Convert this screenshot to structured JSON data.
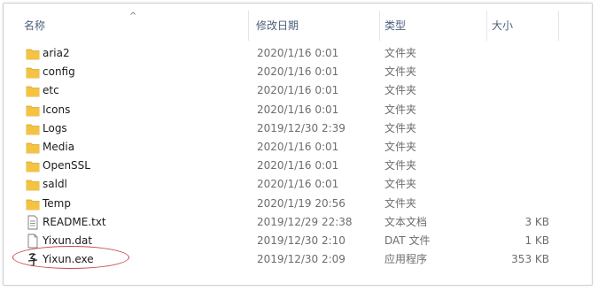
{
  "columns": {
    "name": "名称",
    "date": "修改日期",
    "type": "类型",
    "size": "大小"
  },
  "sort_indicator": "^",
  "files": [
    {
      "name": "aria2",
      "date": "2020/1/16 0:01",
      "type": "文件夹",
      "size": "",
      "icon": "folder-icon"
    },
    {
      "name": "config",
      "date": "2020/1/16 0:01",
      "type": "文件夹",
      "size": "",
      "icon": "folder-icon"
    },
    {
      "name": "etc",
      "date": "2020/1/16 0:01",
      "type": "文件夹",
      "size": "",
      "icon": "folder-icon"
    },
    {
      "name": "Icons",
      "date": "2020/1/16 0:01",
      "type": "文件夹",
      "size": "",
      "icon": "folder-icon"
    },
    {
      "name": "Logs",
      "date": "2019/12/30 2:39",
      "type": "文件夹",
      "size": "",
      "icon": "folder-icon"
    },
    {
      "name": "Media",
      "date": "2020/1/16 0:01",
      "type": "文件夹",
      "size": "",
      "icon": "folder-icon"
    },
    {
      "name": "OpenSSL",
      "date": "2020/1/16 0:01",
      "type": "文件夹",
      "size": "",
      "icon": "folder-icon"
    },
    {
      "name": "saldl",
      "date": "2020/1/16 0:01",
      "type": "文件夹",
      "size": "",
      "icon": "folder-icon"
    },
    {
      "name": "Temp",
      "date": "2020/1/19 20:56",
      "type": "文件夹",
      "size": "",
      "icon": "folder-icon"
    },
    {
      "name": "README.txt",
      "date": "2019/12/29 22:38",
      "type": "文本文档",
      "size": "3 KB",
      "icon": "text-document-icon"
    },
    {
      "name": "Yixun.dat",
      "date": "2019/12/30 2:10",
      "type": "DAT 文件",
      "size": "1 KB",
      "icon": "blank-file-icon"
    },
    {
      "name": "Yixun.exe",
      "date": "2019/12/30 2:09",
      "type": "应用程序",
      "size": "353 KB",
      "icon": "application-icon"
    }
  ],
  "annotation_color": "#c8474a",
  "folder_color": "#f5c342"
}
